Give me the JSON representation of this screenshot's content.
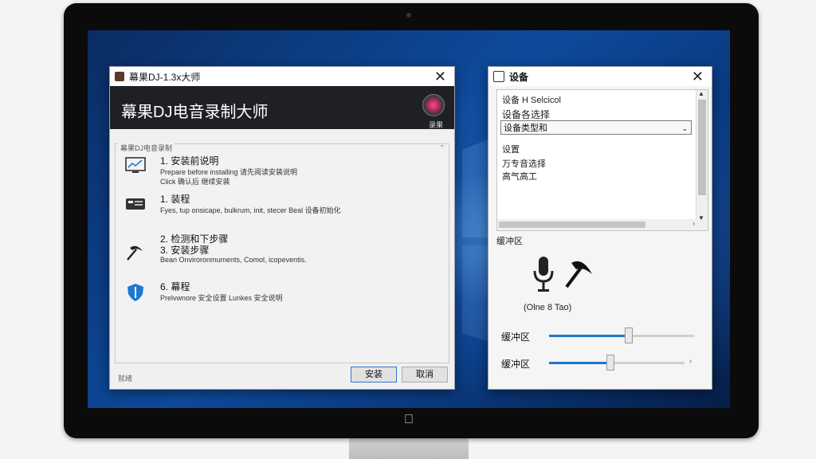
{
  "app": {
    "title": "幕果DJ-1.3x大师",
    "banner_title": "幕果DJ电音录制大师",
    "banner_icon_label": "录果",
    "group_label": "幕果DJ电音录制",
    "footer_text": "就绪",
    "steps": [
      {
        "icon": "monitor-chart-icon",
        "glyph": "📈",
        "title": "1. 安装前说明",
        "desc1": "Prepare before installing 请先阅读安装说明",
        "desc2": "Click 确认后 继续安装"
      },
      {
        "icon": "device-icon",
        "glyph": "▦",
        "title": "1. 装程",
        "desc1": "Fyes, tup onsicape, bulkrum, init, stecer Beal 设备初始化",
        "desc2": ""
      },
      {
        "icon": "pickaxe-icon",
        "glyph": "⛏",
        "title": "2. 检测和下步骤",
        "title2": "3. 安装步骤",
        "desc1": "Bean Onviroronmuments, Comol, icopeventis.",
        "desc2": ""
      },
      {
        "icon": "shield-icon",
        "glyph": "⛨",
        "title": "6. 幕程",
        "desc1": "Prelvwnore 安全设置 Lunkes 安全说明",
        "desc2": ""
      }
    ],
    "buttons": {
      "install": "安装",
      "cancel": "取消"
    }
  },
  "settings": {
    "title": "设备",
    "panel_header": "设备 H Selcicol",
    "device_select_label": "设备各选择",
    "device_select_value": "设备类型和",
    "section_settings": "设置",
    "item1": "万专音选择",
    "item2": "高气高工",
    "buffer_section": "缓冲区",
    "mic_caption": "(Olne 8 Tao)",
    "slider1": {
      "label": "缓冲区",
      "value": 0.55
    },
    "slider2": {
      "label": "缓冲区",
      "value": 0.45
    }
  }
}
